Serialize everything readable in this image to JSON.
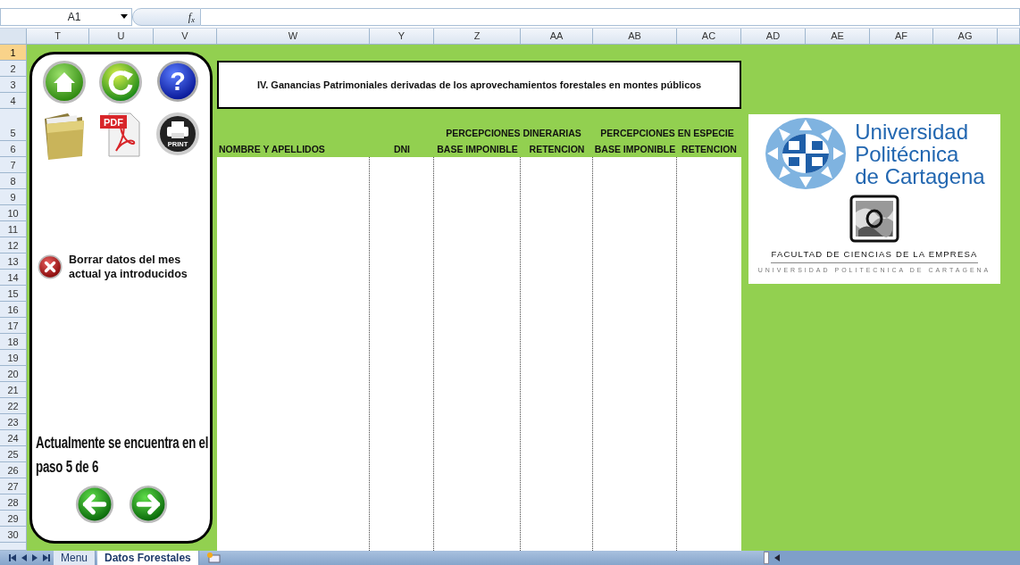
{
  "name_box": "A1",
  "formula_button": "f$_{x}$",
  "column_headers": [
    "T",
    "U",
    "V",
    "W",
    "Y",
    "Z",
    "AA",
    "AB",
    "AC",
    "AD",
    "AE",
    "AF",
    "AG"
  ],
  "row_headers": [
    {
      "label": "1",
      "selected": true
    },
    {
      "label": "2",
      "selected": false
    },
    {
      "label": "3",
      "selected": false
    },
    {
      "label": "4",
      "selected": false
    },
    {
      "label": "5",
      "selected": false
    },
    {
      "label": "6",
      "selected": false
    },
    {
      "label": "7",
      "selected": false
    },
    {
      "label": "8",
      "selected": false
    },
    {
      "label": "9",
      "selected": false
    },
    {
      "label": "10",
      "selected": false
    },
    {
      "label": "11",
      "selected": false
    },
    {
      "label": "12",
      "selected": false
    },
    {
      "label": "13",
      "selected": false
    },
    {
      "label": "14",
      "selected": false
    },
    {
      "label": "15",
      "selected": false
    },
    {
      "label": "16",
      "selected": false
    },
    {
      "label": "17",
      "selected": false
    },
    {
      "label": "18",
      "selected": false
    },
    {
      "label": "19",
      "selected": false
    },
    {
      "label": "20",
      "selected": false
    },
    {
      "label": "21",
      "selected": false
    },
    {
      "label": "22",
      "selected": false
    },
    {
      "label": "23",
      "selected": false
    },
    {
      "label": "24",
      "selected": false
    },
    {
      "label": "25",
      "selected": false
    },
    {
      "label": "26",
      "selected": false
    },
    {
      "label": "27",
      "selected": false
    },
    {
      "label": "28",
      "selected": false
    },
    {
      "label": "29",
      "selected": false
    },
    {
      "label": "30",
      "selected": false
    }
  ],
  "panel": {
    "toolbar": [
      {
        "kind": "home"
      },
      {
        "kind": "refresh"
      },
      {
        "kind": "help",
        "glyph": "?"
      },
      {
        "kind": "folder"
      },
      {
        "kind": "pdf",
        "label": "PDF"
      },
      {
        "kind": "print",
        "label": "PRINT"
      }
    ],
    "clear_button": {
      "label": "Borrar datos del mes actual ya introducidos"
    },
    "step_text": "Actualmente se encuentra en el paso 5 de 6",
    "nav": [
      {
        "kind": "back"
      },
      {
        "kind": "next"
      }
    ]
  },
  "title": "IV. Ganancias Patrimoniales derivadas de los aprovechamientos forestales en montes públicos",
  "table": {
    "groups": [
      {
        "label": "PERCEPCIONES DINERARIAS"
      },
      {
        "label": "PERCEPCIONES EN ESPECIE"
      }
    ],
    "columns": [
      {
        "label": "NOMBRE Y APELLIDOS"
      },
      {
        "label": "DNI"
      },
      {
        "label": "BASE IMPONIBLE"
      },
      {
        "label": "RETENCION"
      },
      {
        "label": "BASE IMPONIBLE"
      },
      {
        "label": "RETENCION"
      }
    ]
  },
  "logo": {
    "name_lines": [
      "Universidad",
      "Politécnica",
      "de Cartagena"
    ],
    "faculty": "FACULTAD DE CIENCIAS DE LA EMPRESA",
    "university": "UNIVERSIDAD POLITECNICA DE CARTAGENA"
  },
  "sheet_tabs": [
    {
      "label": "Menu",
      "selected": false
    },
    {
      "label": "Datos Forestales",
      "selected": true
    }
  ]
}
